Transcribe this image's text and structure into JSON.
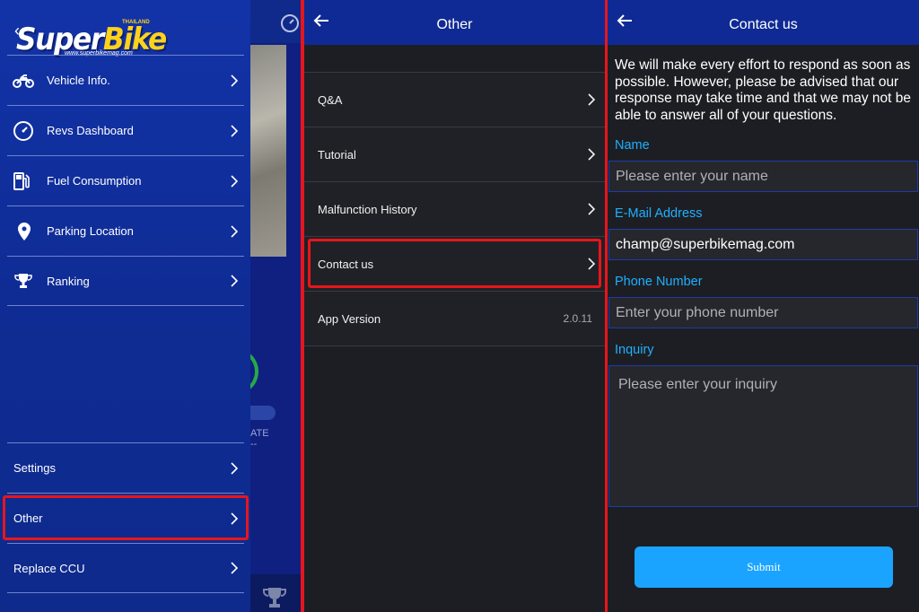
{
  "side_menu": {
    "logo": {
      "brand_super": "Super",
      "brand_bike": "Bike",
      "country": "THAILAND",
      "url": "www.superbikemag.com"
    },
    "items": [
      {
        "label": "Vehicle Info.",
        "icon": "motorcycle-icon"
      },
      {
        "label": "Revs Dashboard",
        "icon": "speedometer-icon"
      },
      {
        "label": "Fuel Consumption",
        "icon": "fuel-pump-icon"
      },
      {
        "label": "Parking Location",
        "icon": "location-pin-icon"
      },
      {
        "label": "Ranking",
        "icon": "trophy-icon"
      }
    ],
    "bottom_items": [
      {
        "label": "Settings"
      },
      {
        "label": "Other",
        "highlighted": true
      },
      {
        "label": "Replace CCU"
      }
    ],
    "background_partial_text": "ATE",
    "background_partial_value": "--"
  },
  "other_screen": {
    "title": "Other",
    "rows": [
      {
        "label": "Q&A"
      },
      {
        "label": "Tutorial"
      },
      {
        "label": "Malfunction History"
      },
      {
        "label": "Contact us",
        "highlighted": true
      },
      {
        "label": "App Version",
        "value": "2.0.11"
      }
    ]
  },
  "contact_screen": {
    "title": "Contact us",
    "intro": "We will make every effort to respond as soon as possible. However, please be advised that our response may take time and that we may not be able to answer all of your questions.",
    "fields": {
      "name": {
        "label": "Name",
        "placeholder": "Please enter your name",
        "value": ""
      },
      "email": {
        "label": "E-Mail Address",
        "placeholder": "",
        "value": "champ@superbikemag.com"
      },
      "phone": {
        "label": "Phone Number",
        "placeholder": "Enter your phone number",
        "value": ""
      },
      "inquiry": {
        "label": "Inquiry",
        "placeholder": "Please enter your inquiry",
        "value": ""
      }
    },
    "submit_label": "Submit"
  },
  "colors": {
    "drawer_blue": "#1233a8",
    "navbar_blue": "#0f2a94",
    "dark_bg": "#1d1e23",
    "label_blue": "#1eb0ff",
    "button_blue": "#1aa4ff",
    "highlight_red": "#e8151b"
  }
}
